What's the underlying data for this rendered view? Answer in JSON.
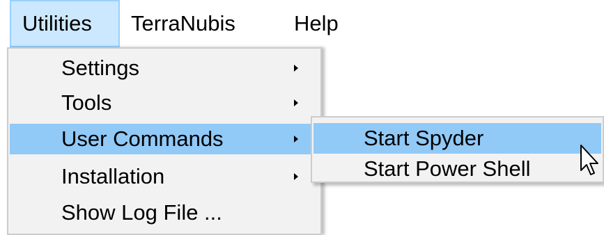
{
  "menubar": {
    "items": [
      {
        "label": "Utilities"
      },
      {
        "label": "TerraNubis"
      },
      {
        "label": "Help"
      }
    ]
  },
  "utilities_menu": {
    "items": [
      {
        "label": "Settings",
        "has_submenu": true
      },
      {
        "label": "Tools",
        "has_submenu": true
      },
      {
        "label": "User Commands",
        "has_submenu": true,
        "highlighted": true
      },
      {
        "label": "Installation",
        "has_submenu": true
      },
      {
        "label": "Show Log File ...",
        "has_submenu": false
      }
    ]
  },
  "user_commands_submenu": {
    "items": [
      {
        "label": "Start Spyder",
        "highlighted": true
      },
      {
        "label": "Start Power Shell"
      }
    ]
  },
  "colors": {
    "menubar_active_bg": "#cce8ff",
    "menu_bg": "#f2f2f2",
    "highlight_bg": "#91c9f7"
  },
  "icons": {
    "cursor": "mouse-pointer-icon",
    "submenu_arrow": "chevron-right-icon"
  }
}
